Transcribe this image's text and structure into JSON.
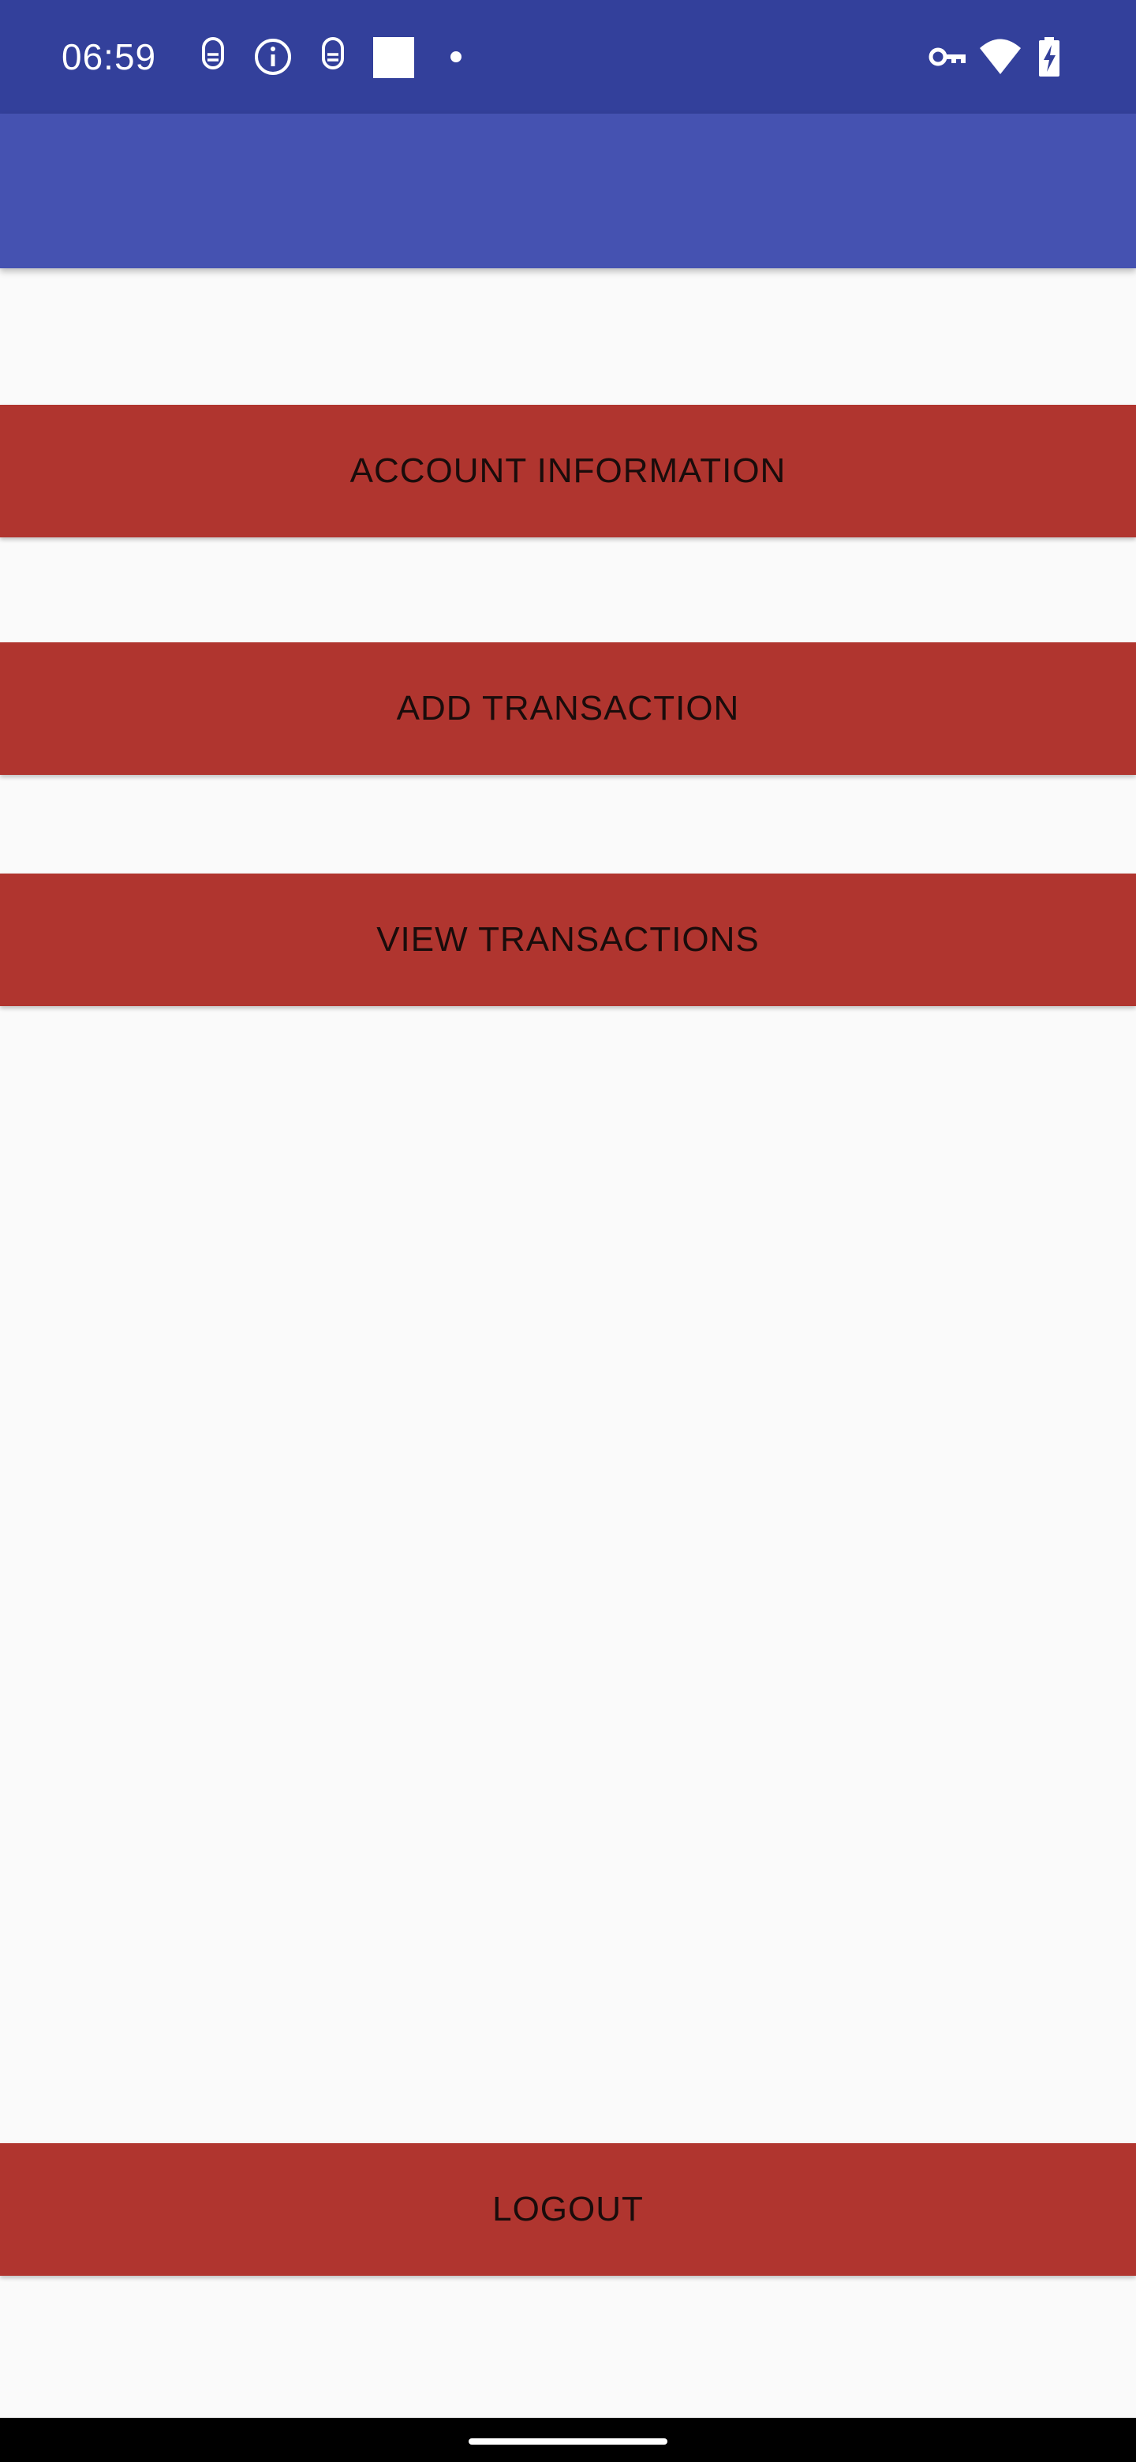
{
  "status_bar": {
    "time": "06:59",
    "background_color": "#33409b",
    "left_icons": [
      "sim-toolkit-icon",
      "info-icon",
      "sim-toolkit-icon",
      "white-square-icon",
      "dot-icon"
    ],
    "right_icons": [
      "vpn-key-icon",
      "wifi-icon",
      "battery-charging-icon"
    ]
  },
  "app_bar": {
    "background_color": "#4552b1"
  },
  "menu": {
    "button_color": "#b0352f",
    "account_information_label": "ACCOUNT INFORMATION",
    "add_transaction_label": "ADD TRANSACTION",
    "view_transactions_label": "VIEW TRANSACTIONS",
    "logout_label": "LOGOUT"
  }
}
